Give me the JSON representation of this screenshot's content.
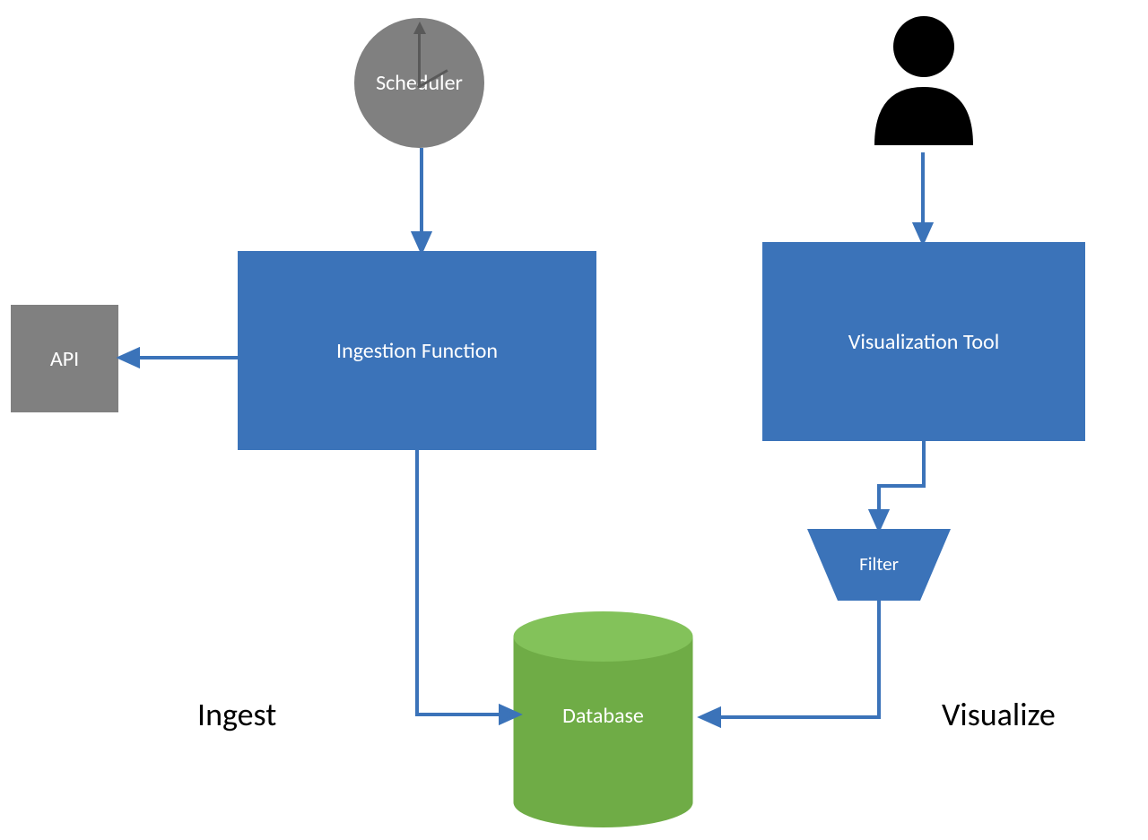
{
  "nodes": {
    "scheduler": "Scheduler",
    "api": "API",
    "ingestion": "Ingestion Function",
    "visualization": "Visualization Tool",
    "filter": "Filter",
    "database": "Database"
  },
  "sections": {
    "ingest": "Ingest",
    "visualize": "Visualize"
  },
  "colors": {
    "blue": "#3b73b9",
    "gray": "#808080",
    "green": "#6fac46",
    "black": "#000000"
  },
  "diagram": {
    "type": "data-pipeline-architecture",
    "flows": [
      {
        "from": "scheduler",
        "to": "ingestion"
      },
      {
        "from": "ingestion",
        "to": "api"
      },
      {
        "from": "ingestion",
        "to": "database"
      },
      {
        "from": "user",
        "to": "visualization"
      },
      {
        "from": "visualization",
        "to": "filter"
      },
      {
        "from": "filter",
        "to": "database"
      }
    ]
  }
}
